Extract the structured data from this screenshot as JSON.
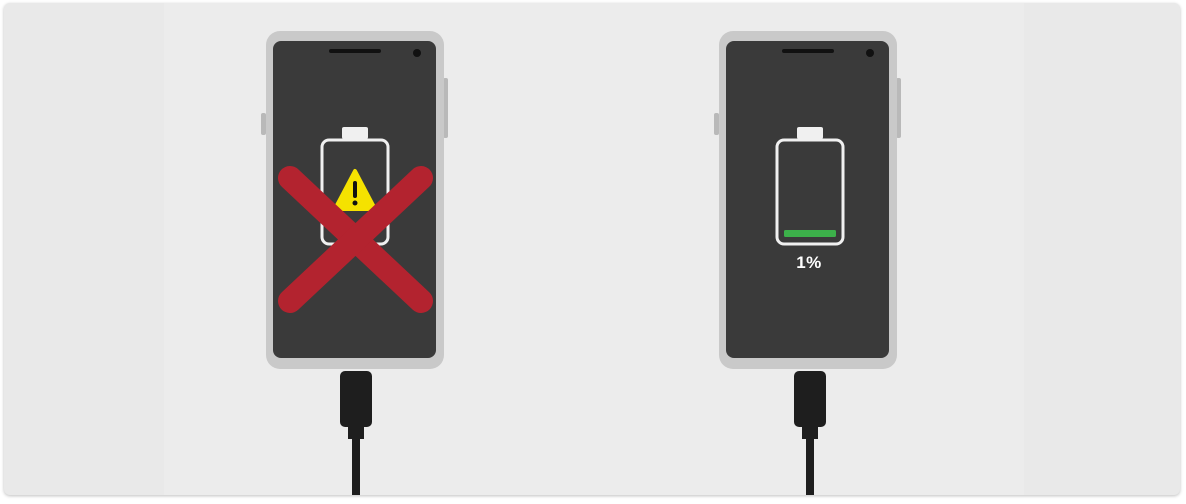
{
  "scene": {
    "left_phone": {
      "state": "battery-fault",
      "indicator": "warning-triangle",
      "overlay": "red-x"
    },
    "right_phone": {
      "state": "charging",
      "battery_level_fraction": 0.01,
      "battery_label": "1%"
    }
  },
  "colors": {
    "background": "#e9e9e9",
    "phone_frame": "#c8c8c8",
    "screen": "#3a3a3a",
    "cross": "#b3232f",
    "warning": "#f5e200",
    "battery_fill": "#3cb04a",
    "cable": "#1e1e1e"
  }
}
